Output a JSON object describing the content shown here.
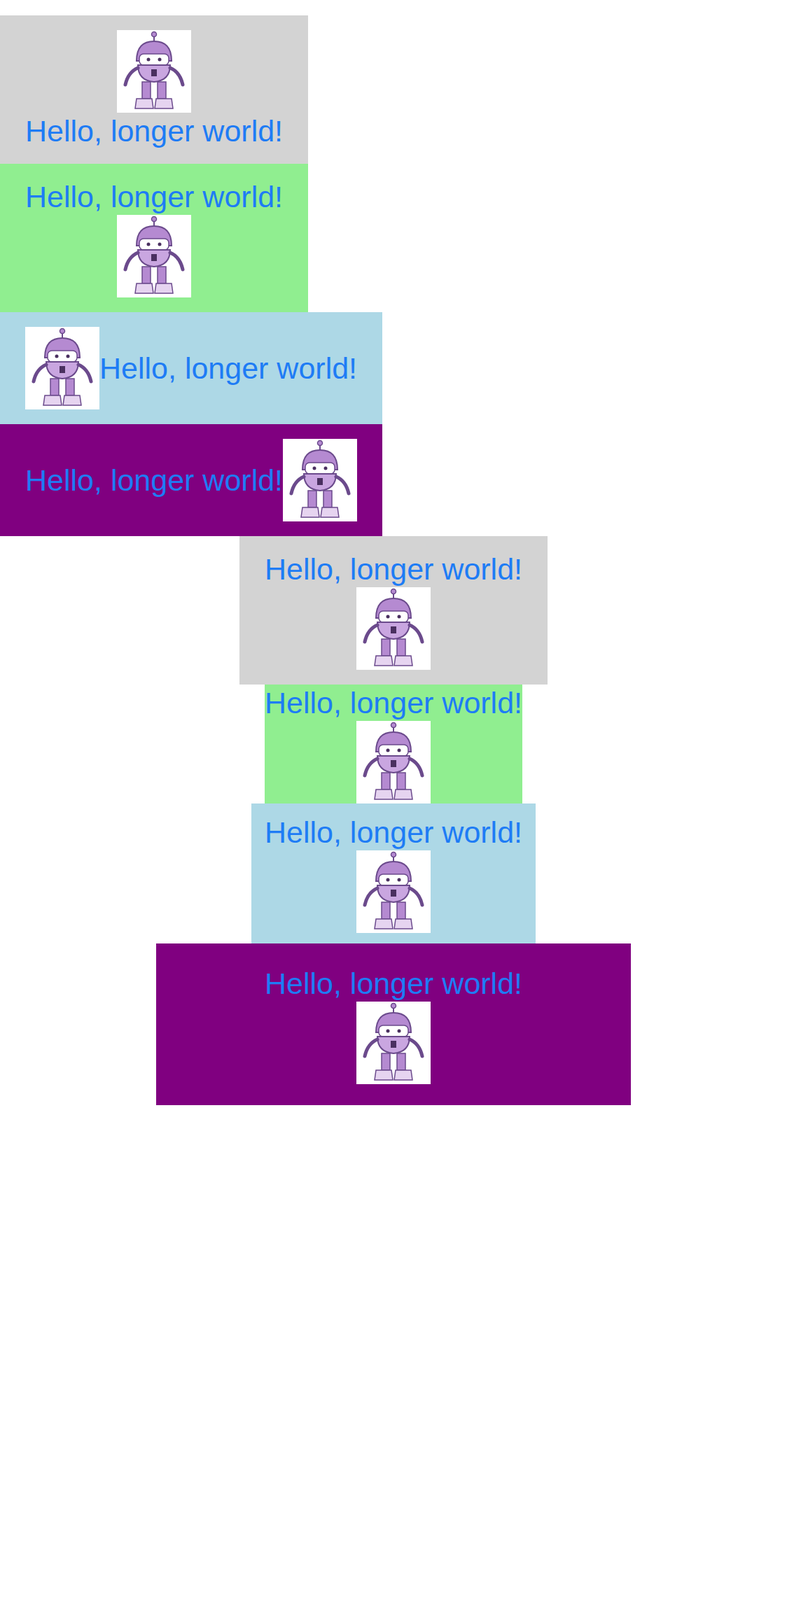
{
  "rows": [
    {
      "text": "Hello, longer world!",
      "kind": "image-above",
      "color": "#d3d3d3"
    },
    {
      "text": "Hello, longer world!",
      "kind": "text-above",
      "color": "#90ee90"
    },
    {
      "text": "Hello, longer world!",
      "kind": "image-left",
      "color": "#add8e6"
    },
    {
      "text": "Hello, longer world!",
      "kind": "text-left",
      "color": "#800080"
    },
    {
      "text": "Hello, longer world!",
      "kind": "text-above",
      "color": "#d3d3d3"
    },
    {
      "text": "Hello, longer world!",
      "kind": "text-above",
      "color": "#90ee90"
    },
    {
      "text": "Hello, longer world!",
      "kind": "text-above",
      "color": "#add8e6"
    },
    {
      "text": "Hello, longer world!",
      "kind": "text-above",
      "color": "#800080"
    }
  ]
}
